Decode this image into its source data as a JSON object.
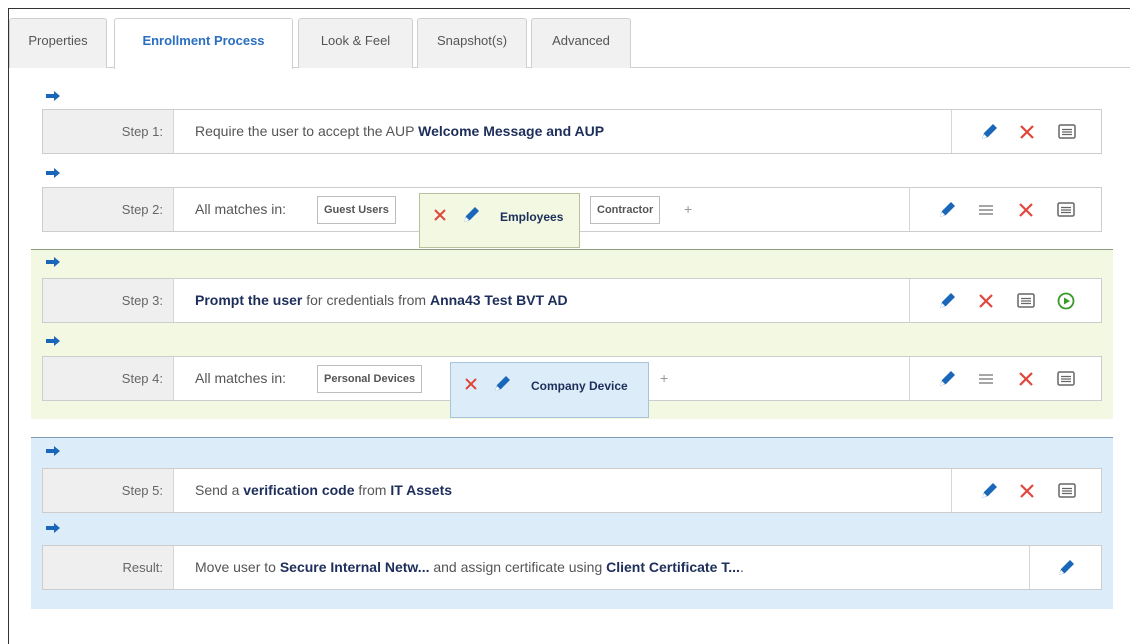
{
  "tabs": [
    {
      "label": "Properties",
      "active": false
    },
    {
      "label": "Enrollment Process",
      "active": true
    },
    {
      "label": "Look & Feel",
      "active": false
    },
    {
      "label": "Snapshot(s)",
      "active": false
    },
    {
      "label": "Advanced",
      "active": false
    }
  ],
  "steps": {
    "step1": {
      "label": "Step 1:",
      "text": "Require the user to accept the AUP ",
      "bold": "Welcome Message and AUP"
    },
    "step2": {
      "label": "Step 2:",
      "text": "All matches in:",
      "chips": [
        "Guest Users",
        "Employees",
        "Contractor"
      ],
      "plus": "+"
    },
    "step3": {
      "label": "Step 3:",
      "bold1": "Prompt the user",
      "text": " for credentials from ",
      "bold2": "Anna43 Test BVT AD"
    },
    "step4": {
      "label": "Step 4:",
      "text": "All matches in:",
      "chips": [
        "Personal Devices",
        "Company Device"
      ],
      "plus": "+"
    },
    "step5": {
      "label": "Step 5:",
      "text1": "Send a ",
      "bold1": "verification code",
      "text2": " from ",
      "bold2": "IT Assets"
    },
    "result": {
      "label": "Result:",
      "text1": "Move user to ",
      "bold1": "Secure Internal Netw...",
      "text2": " and assign certificate using ",
      "bold2": "Client Certificate T...",
      "tail": "."
    }
  },
  "colors": {
    "accent_blue": "#1a66b8",
    "delete_red": "#e0473c",
    "run_green": "#3a9a2a",
    "group_green": "#f2f8e1",
    "group_blue": "#dcecf9"
  },
  "icons": [
    "arrow-right-icon",
    "edit-icon",
    "delete-icon",
    "comment-icon",
    "reorder-icon",
    "run-icon",
    "add-icon"
  ]
}
